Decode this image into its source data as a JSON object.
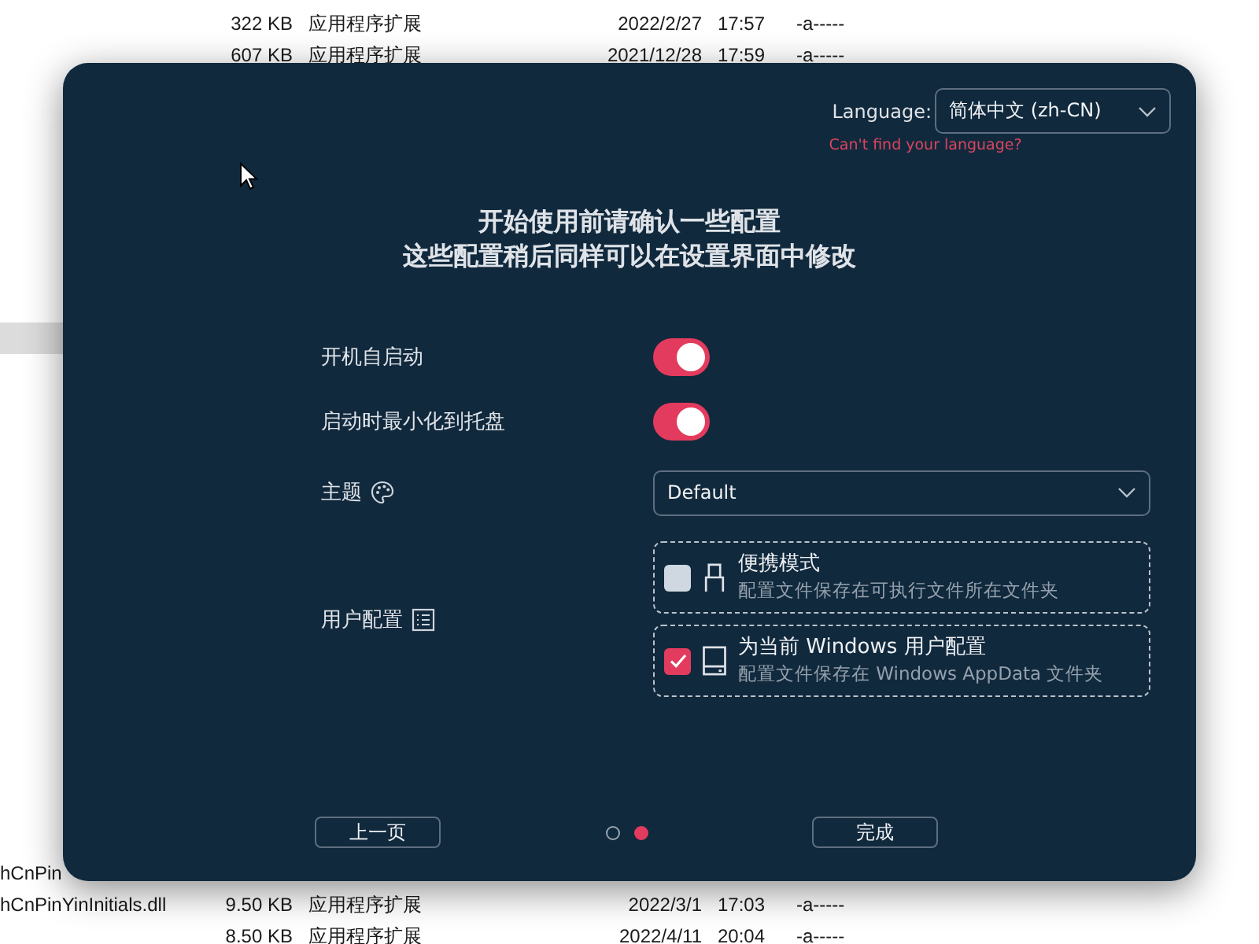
{
  "background_list": {
    "top_rows": [
      {
        "name": "",
        "size": "322 KB",
        "type": "应用程序扩展",
        "date": "2022/2/27",
        "time": "17:57",
        "attributes": "-a-----"
      },
      {
        "name": "",
        "size": "607 KB",
        "type": "应用程序扩展",
        "date": "2021/12/28",
        "time": "17:59",
        "attributes": "-a-----"
      }
    ],
    "bottom_rows": [
      {
        "name": "hCnPin",
        "size": "",
        "type": "",
        "date": "",
        "time": "",
        "attributes": ""
      },
      {
        "name": "hCnPinYinInitials.dll",
        "size": "9.50 KB",
        "type": "应用程序扩展",
        "date": "2022/3/1",
        "time": "17:03",
        "attributes": "-a-----"
      },
      {
        "name": "",
        "size": "8.50 KB",
        "type": "应用程序扩展",
        "date": "2022/4/11",
        "time": "20:04",
        "attributes": "-a-----"
      }
    ]
  },
  "dialog": {
    "language": {
      "label": "Language:",
      "value": "简体中文 (zh-CN)",
      "help_link": "Can't find your language?"
    },
    "heading": "开始使用前请确认一些配置",
    "subheading": "这些配置稍后同样可以在设置界面中修改",
    "settings": [
      {
        "kind": "toggle",
        "label": "开机自启动",
        "on": true
      },
      {
        "kind": "toggle",
        "label": "启动时最小化到托盘",
        "on": true
      },
      {
        "kind": "select",
        "label": "主题",
        "value": "Default"
      },
      {
        "kind": "options",
        "label": "用户配置",
        "options": [
          {
            "title": "便携模式",
            "description": "配置文件保存在可执行文件所在文件夹",
            "checked": false
          },
          {
            "title": "为当前 Windows 用户配置",
            "description": "配置文件保存在 Windows AppData 文件夹",
            "checked": true
          }
        ]
      }
    ],
    "footer": {
      "back_button": "上一页",
      "pages": [
        {
          "selected": false
        },
        {
          "selected": true
        }
      ],
      "finish_button": "完成"
    }
  }
}
